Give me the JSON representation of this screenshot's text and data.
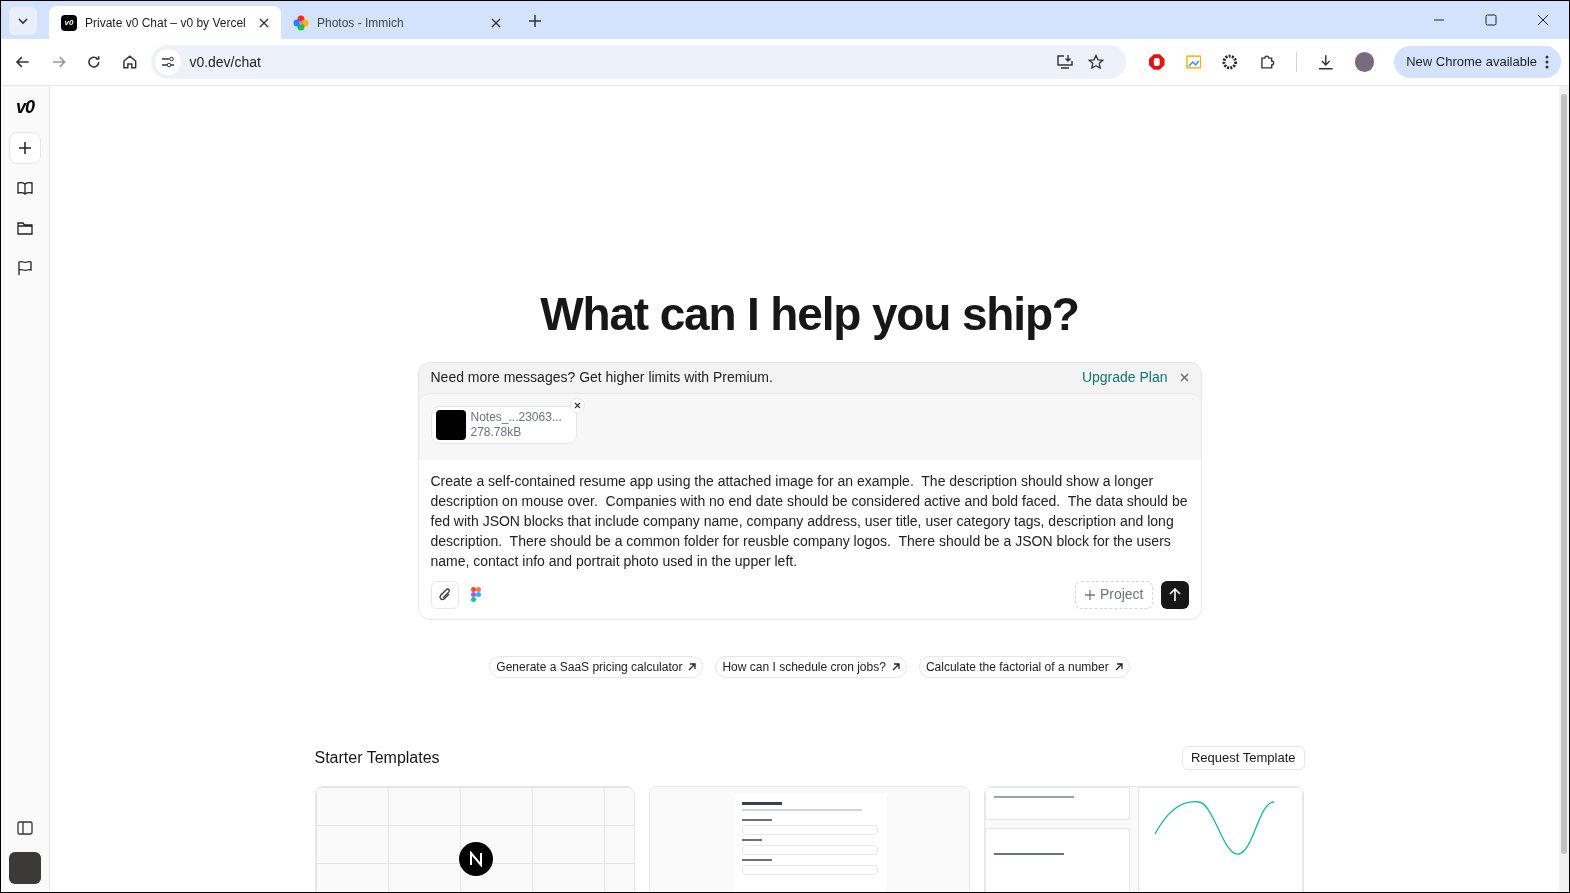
{
  "browser": {
    "tabs": [
      {
        "kind": "text-favicon",
        "favicon": "v0",
        "title": "Private v0 Chat – v0 by Vercel",
        "selected": true
      },
      {
        "kind": "flower-favicon",
        "title": "Photos - Immich",
        "selected": false
      }
    ],
    "url": "v0.dev/chat",
    "update_button": "New Chrome available"
  },
  "sidebar": {
    "logo": "v0",
    "items": [
      {
        "kind": "new"
      },
      {
        "kind": "book"
      },
      {
        "kind": "folder"
      },
      {
        "kind": "flag"
      }
    ]
  },
  "heading": "What can I help you ship?",
  "banner": {
    "text": "Need more messages? Get higher limits with Premium.",
    "link": "Upgrade Plan"
  },
  "attachment": {
    "name": "Notes_...23063...",
    "size": "278.78kB"
  },
  "prompt": "Create a self-contained resume app using the attached image for an example.  The description should show a longer description on mouse over.  Companies with no end date should be considered active and bold faced.  The data should be fed with JSON blocks that include company name, company address, user title, user category tags, description and long description.  There should be a common folder for reusble company logos.  There should be a JSON block for the users name, contact info and portrait photo used in the upper left.",
  "project_button": "Project",
  "suggestions": [
    "Generate a SaaS pricing calculator",
    "How can I schedule cron jobs?",
    "Calculate the factorial of a number"
  ],
  "templates": {
    "title": "Starter Templates",
    "request_button": "Request Template",
    "cards": [
      {
        "kind": "logo"
      },
      {
        "kind": "form"
      },
      {
        "kind": "dashboard"
      }
    ]
  }
}
